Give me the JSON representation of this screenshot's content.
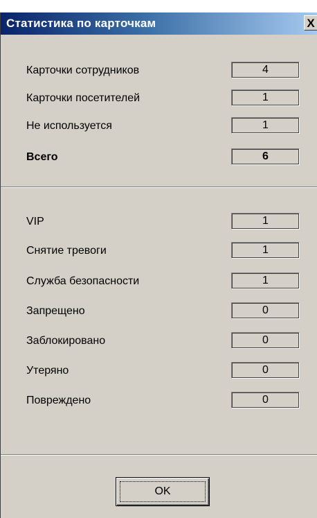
{
  "window": {
    "title": "Статистика по карточкам",
    "close_label": "X"
  },
  "group1": {
    "rows": [
      {
        "label": "Карточки сотрудников",
        "value": "4"
      },
      {
        "label": "Карточки посетителей",
        "value": "1"
      },
      {
        "label": "Не используется",
        "value": "1"
      },
      {
        "label": "Всего",
        "value": "6"
      }
    ]
  },
  "group2": {
    "rows": [
      {
        "label": "VIP",
        "value": "1"
      },
      {
        "label": "Снятие тревоги",
        "value": "1"
      },
      {
        "label": "Служба безопасности",
        "value": "1"
      },
      {
        "label": "Запрещено",
        "value": "0"
      },
      {
        "label": "Заблокировано",
        "value": "0"
      },
      {
        "label": "Утеряно",
        "value": "0"
      },
      {
        "label": "Повреждено",
        "value": "0"
      }
    ]
  },
  "buttons": {
    "ok_label": "OK"
  },
  "colors": {
    "titlebar_start": "#0a246a",
    "titlebar_end": "#a6caf0",
    "dialog_background": "#d4d0c8"
  }
}
